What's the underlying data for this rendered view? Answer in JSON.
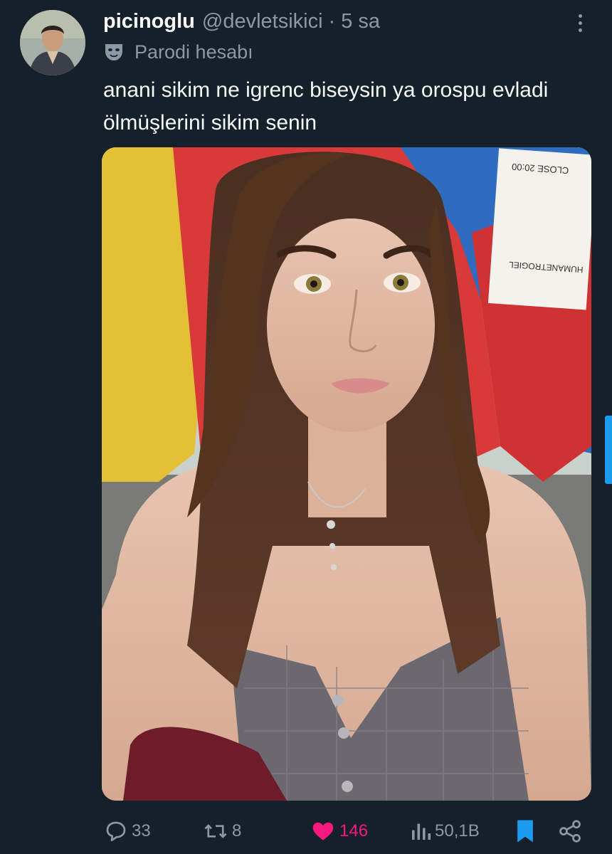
{
  "tweet": {
    "author": {
      "display_name": "picinoglu",
      "handle": "@devletsikici",
      "separator": "·",
      "time": "5 sa",
      "label": "Parodi hesabı",
      "label_icon": "theater-mask-icon"
    },
    "text": "anani sikim ne igrenc biseysin ya orospu evladi ölmüşlerini sikim senin",
    "media": {
      "type": "photo",
      "sign_text_top": "CLOSE 20:00",
      "sign_text_bottom": "HUMANETROGIEL"
    },
    "actions": {
      "reply": {
        "icon": "reply-icon",
        "count": "33"
      },
      "retweet": {
        "icon": "retweet-icon",
        "count": "8"
      },
      "like": {
        "icon": "heart-icon",
        "count": "146",
        "active": true,
        "color": "#f91880"
      },
      "views": {
        "icon": "views-icon",
        "count": "50,1B"
      },
      "bookmark": {
        "icon": "bookmark-icon",
        "active": true,
        "color": "#1d9bf0"
      },
      "share": {
        "icon": "share-icon"
      }
    }
  },
  "theme": {
    "background": "#15202b",
    "primary_text": "#f7f9f9",
    "secondary_text": "#8b98a5",
    "accent": "#1d9bf0"
  }
}
